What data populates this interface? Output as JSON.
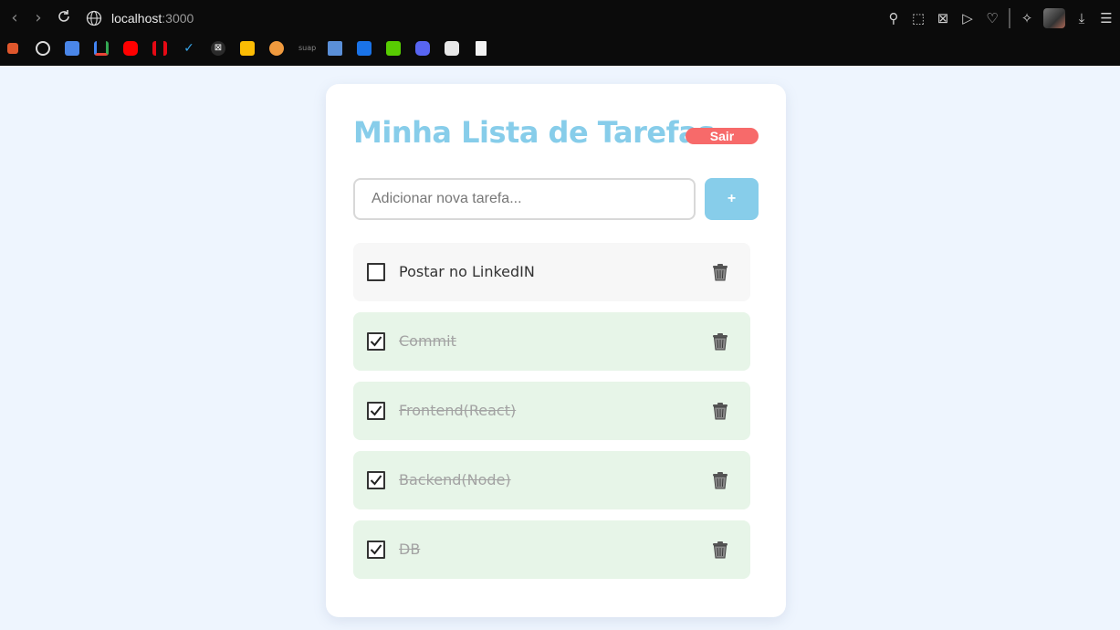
{
  "browser": {
    "url_host": "localhost",
    "url_port": ":3000",
    "bookmark_icons": [
      "favicon-orange",
      "openai-icon",
      "google-translate-icon",
      "gmail-icon",
      "youtube-icon",
      "netflix-icon",
      "check-icon",
      "notion-icon",
      "keep-icon",
      "orange-app-icon",
      "suap-icon",
      "graduation-icon",
      "contacts-icon",
      "duolingo-icon",
      "discord-icon",
      "robot-icon",
      "page-icon"
    ],
    "bookmark_text": "suap"
  },
  "app": {
    "title": "Minha Lista de Tarefas",
    "logout_label": "Sair",
    "input_placeholder": "Adicionar nova tarefa...",
    "add_label": "+",
    "accent_color": "#87cdea",
    "danger_color": "#f76a6a",
    "done_bg": "#e7f5e8"
  },
  "tasks": [
    {
      "label": "Postar no LinkedIN",
      "done": false
    },
    {
      "label": "Commit",
      "done": true
    },
    {
      "label": "Frontend(React)",
      "done": true
    },
    {
      "label": "Backend(Node)",
      "done": true
    },
    {
      "label": "DB",
      "done": true
    }
  ]
}
